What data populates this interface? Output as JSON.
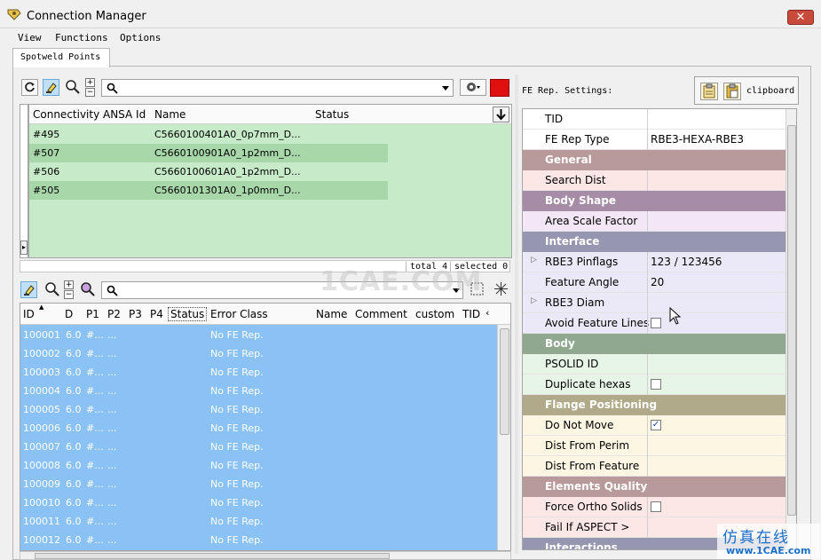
{
  "window": {
    "title": "Connection Manager",
    "close_label": "✕"
  },
  "menu": {
    "items": [
      "View",
      "Functions",
      "Options"
    ]
  },
  "tabs": {
    "active": "Spotweld Points"
  },
  "upper_table": {
    "columns": [
      "Connectivity",
      "ANSA Id",
      "Name",
      "Status"
    ],
    "rows": [
      {
        "connectivity": "#495",
        "ansa_id": "",
        "name": "C5660100401A0_0p7mm_D...",
        "status": ""
      },
      {
        "connectivity": "#507",
        "ansa_id": "",
        "name": "C5660100901A0_1p2mm_D...",
        "status": ""
      },
      {
        "connectivity": "#506",
        "ansa_id": "",
        "name": "C5660100601A0_1p2mm_D...",
        "status": ""
      },
      {
        "connectivity": "#505",
        "ansa_id": "",
        "name": "C5660101301A0_1p0mm_D...",
        "status": ""
      }
    ],
    "total_label": "total 4",
    "selected_label": "selected 0"
  },
  "lower_table": {
    "columns": [
      "ID",
      "D",
      "P1",
      "P2",
      "P3",
      "P4",
      "Status",
      "Error Class",
      "Name",
      "Comment",
      "custom",
      "TID"
    ],
    "rows": [
      {
        "id": "100001",
        "d": "6.0",
        "p1": "#...",
        "p2": "...",
        "error_class": "No FE Rep."
      },
      {
        "id": "100002",
        "d": "6.0",
        "p1": "#...",
        "p2": "...",
        "error_class": "No FE Rep."
      },
      {
        "id": "100003",
        "d": "6.0",
        "p1": "#...",
        "p2": "...",
        "error_class": "No FE Rep."
      },
      {
        "id": "100004",
        "d": "6.0",
        "p1": "#...",
        "p2": "...",
        "error_class": "No FE Rep."
      },
      {
        "id": "100005",
        "d": "6.0",
        "p1": "#...",
        "p2": "...",
        "error_class": "No FE Rep."
      },
      {
        "id": "100006",
        "d": "6.0",
        "p1": "#...",
        "p2": "...",
        "error_class": "No FE Rep."
      },
      {
        "id": "100007",
        "d": "6.0",
        "p1": "#...",
        "p2": "...",
        "error_class": "No FE Rep."
      },
      {
        "id": "100008",
        "d": "6.0",
        "p1": "#...",
        "p2": "...",
        "error_class": "No FE Rep."
      },
      {
        "id": "100009",
        "d": "6.0",
        "p1": "#...",
        "p2": "...",
        "error_class": "No FE Rep."
      },
      {
        "id": "100010",
        "d": "6.0",
        "p1": "#...",
        "p2": "...",
        "error_class": "No FE Rep."
      },
      {
        "id": "100011",
        "d": "6.0",
        "p1": "#...",
        "p2": "...",
        "error_class": "No FE Rep."
      },
      {
        "id": "100012",
        "d": "6.0",
        "p1": "#...",
        "p2": "...",
        "error_class": "No FE Rep."
      }
    ]
  },
  "fe_settings": {
    "label": "FE Rep. Settings:",
    "clipboard_label": "clipboard",
    "rows": [
      {
        "kind": "prop",
        "name": "TID",
        "value": "",
        "bg": "#ffffff"
      },
      {
        "kind": "prop",
        "name": "FE Rep Type",
        "value": "RBE3-HEXA-RBE3",
        "bg": "#ffffff"
      },
      {
        "kind": "head",
        "name": "General",
        "bg": "#b89a9a"
      },
      {
        "kind": "prop",
        "name": "Search Dist",
        "value": "",
        "bg": "#fde6e6"
      },
      {
        "kind": "head",
        "name": "Body Shape",
        "bg": "#a68ca6"
      },
      {
        "kind": "prop",
        "name": "Area Scale Factor",
        "value": "",
        "bg": "#f3e6f6"
      },
      {
        "kind": "head",
        "name": "Interface",
        "bg": "#9696b0"
      },
      {
        "kind": "prop",
        "name": "RBE3 Pinflags",
        "value": "123 / 123456",
        "bg": "#ebe8f7",
        "expand": true
      },
      {
        "kind": "prop",
        "name": "Feature Angle",
        "value": "20",
        "bg": "#ebe8f7"
      },
      {
        "kind": "prop",
        "name": "RBE3 Diam",
        "value": "",
        "bg": "#ebe8f7",
        "expand": true
      },
      {
        "kind": "prop",
        "name": "Avoid Feature Lines",
        "value": "",
        "bg": "#ebe8f7",
        "checkbox": true,
        "checked": false
      },
      {
        "kind": "head",
        "name": "Body",
        "bg": "#90a890"
      },
      {
        "kind": "prop",
        "name": "PSOLID ID",
        "value": "",
        "bg": "#e6f5e6"
      },
      {
        "kind": "prop",
        "name": "Duplicate hexas",
        "value": "",
        "bg": "#e6f5e6",
        "checkbox": true,
        "checked": false
      },
      {
        "kind": "head",
        "name": "Flange Positioning",
        "bg": "#b0aa8a"
      },
      {
        "kind": "prop",
        "name": "Do Not Move",
        "value": "",
        "bg": "#fdf6e3",
        "checkbox": true,
        "checked": true
      },
      {
        "kind": "prop",
        "name": "Dist From Perim",
        "value": "",
        "bg": "#fdf6e3"
      },
      {
        "kind": "prop",
        "name": "Dist From Feature",
        "value": "",
        "bg": "#fdf6e3"
      },
      {
        "kind": "head",
        "name": "Elements Quality",
        "bg": "#b89a9a"
      },
      {
        "kind": "prop",
        "name": "Force Ortho Solids",
        "value": "",
        "bg": "#fde6e6",
        "checkbox": true,
        "checked": false
      },
      {
        "kind": "prop",
        "name": "Fail If ASPECT >",
        "value": "",
        "bg": "#fde6e6"
      },
      {
        "kind": "head",
        "name": "Interactions",
        "bg": "#9696b0"
      }
    ]
  },
  "watermark": {
    "center": "1CAE.COM",
    "corner": "仿真在线",
    "corner_url": "www.1CAE.com"
  },
  "icons": [
    "app-icon",
    "refresh-icon",
    "highlight-icon",
    "zoom-icon",
    "plus-icon",
    "minus-icon",
    "search-icon",
    "dropdown-icon",
    "settings-icon",
    "red-square-icon",
    "download-arrow-icon",
    "clipboard-icon"
  ]
}
